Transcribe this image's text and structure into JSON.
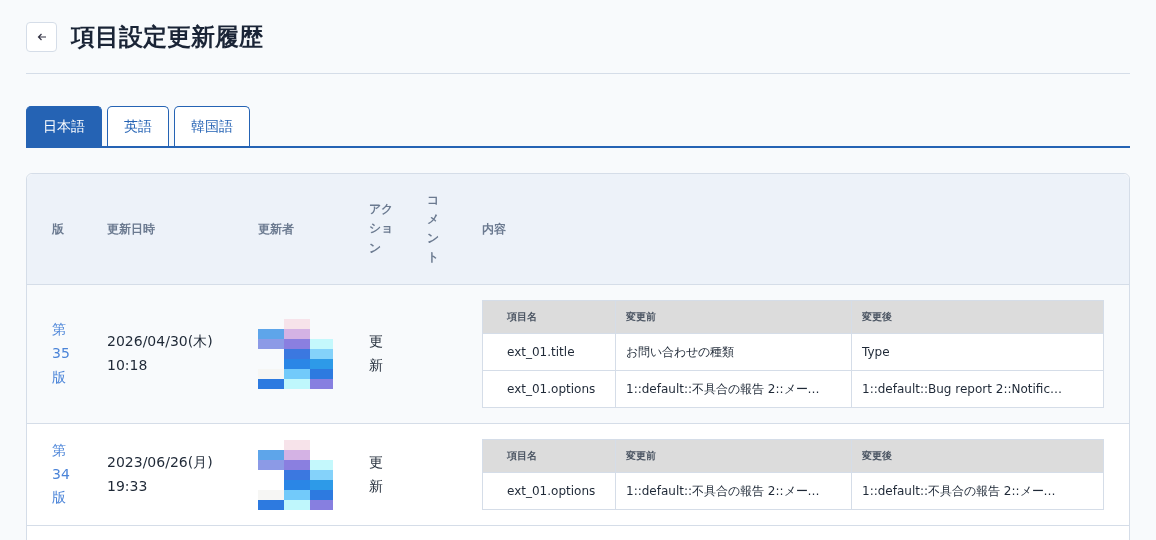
{
  "page": {
    "title": "項目設定更新履歴"
  },
  "tabs": [
    {
      "label": "日本語",
      "selected": true
    },
    {
      "label": "英語",
      "selected": false
    },
    {
      "label": "韓国語",
      "selected": false
    }
  ],
  "table": {
    "columns": [
      "版",
      "更新日時",
      "更新者",
      "アクション",
      "コメント",
      "内容"
    ],
    "rows": [
      {
        "version": "第35版",
        "date": "2026/04/30(木)",
        "time": "10:18",
        "action": "更新",
        "changes": {
          "columns": [
            "項目名",
            "変更前",
            "変更後"
          ],
          "rows": [
            [
              "ext_01.title",
              "お問い合わせの種類",
              "Type"
            ],
            [
              "ext_01.options",
              "1::default::不具合の報告 2::メー…",
              "1::default::Bug report 2::Notific…"
            ]
          ]
        }
      },
      {
        "version": "第34版",
        "date": "2023/06/26(月)",
        "time": "19:33",
        "action": "更新",
        "changes": {
          "columns": [
            "項目名",
            "変更前",
            "変更後"
          ],
          "rows": [
            [
              "ext_01.options",
              "1::default::不具合の報告 2::メー…",
              "1::default::不具合の報告 2::メー…"
            ]
          ]
        }
      }
    ]
  }
}
